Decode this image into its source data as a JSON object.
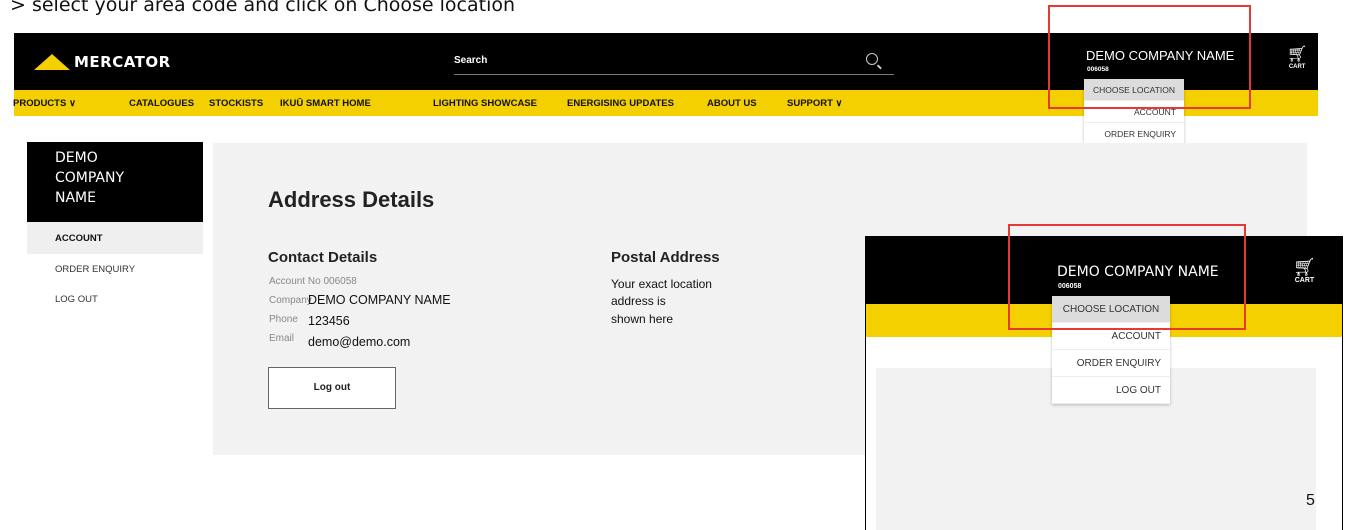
{
  "instruction": "> select your area code and click on Choose location",
  "header": {
    "logo_text": "MERCATOR",
    "search_label": "Search",
    "company_name": "DEMO COMPANY NAME",
    "account_no": "006058",
    "cart_label": "CART"
  },
  "nav": {
    "items": [
      "PRODUCTS ∨",
      "CATALOGUES",
      "STOCKISTS",
      "IKUŪ SMART HOME",
      "LIGHTING SHOWCASE",
      "ENERGISING UPDATES",
      "ABOUT US",
      "SUPPORT ∨"
    ]
  },
  "dropdown": {
    "items": [
      "CHOOSE LOCATION",
      "ACCOUNT",
      "ORDER ENQUIRY",
      "LOG OUT"
    ]
  },
  "sidebar": {
    "title": [
      "DEMO",
      "COMPANY",
      "NAME"
    ],
    "items": [
      "ACCOUNT",
      "ORDER ENQUIRY",
      "LOG OUT"
    ]
  },
  "content": {
    "title": "Address Details",
    "contact": {
      "heading": "Contact Details",
      "account_label": "Account No",
      "account_value": "006058",
      "company_label": "Company",
      "company_value": "DEMO COMPANY NAME",
      "phone_label": "Phone",
      "phone_value": "123456",
      "email_label": "Email",
      "email_value": "demo@demo.com"
    },
    "postal": {
      "heading": "Postal Address",
      "lines": [
        "Your exact location",
        "address is",
        "shown here"
      ]
    },
    "logout_button": "Log out"
  },
  "page_number": "5",
  "colors": {
    "header_bg": "#000000",
    "accent_yellow": "#f5d000",
    "highlight_red": "#e53935"
  }
}
